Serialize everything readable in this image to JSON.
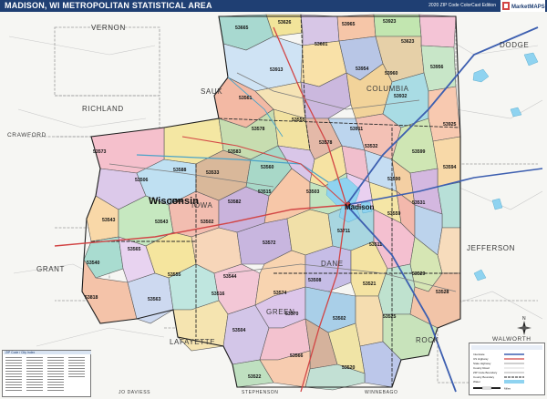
{
  "header": {
    "title": "MADISON, WI METROPOLITAN STATISTICAL AREA",
    "edition": "2020 ZIP Code ColorCast Edition",
    "logo_text": "MarketMAPS"
  },
  "colors": {
    "header_bg": "#1f3f73",
    "water": "#8fd3f0",
    "outside_area": "#f5f5f2",
    "road_interstate": "#3d5fb0",
    "road_us": "#d24545"
  },
  "counties": [
    {
      "name": "VERNON"
    },
    {
      "name": "SAUK"
    },
    {
      "name": "COLUMBIA"
    },
    {
      "name": "DODGE"
    },
    {
      "name": "RICHLAND"
    },
    {
      "name": "CRAWFORD"
    },
    {
      "name": "IOWA"
    },
    {
      "name": "DANE"
    },
    {
      "name": "JEFFERSON"
    },
    {
      "name": "GRANT"
    },
    {
      "name": "LAFAYETTE"
    },
    {
      "name": "GREEN"
    },
    {
      "name": "ROCK"
    },
    {
      "name": "WALWORTH"
    },
    {
      "name": "JO DAVIESS"
    },
    {
      "name": "STEPHENSON"
    },
    {
      "name": "WINNEBAGO"
    }
  ],
  "cities": [
    {
      "name": "Wisconsin"
    },
    {
      "name": "Madison"
    }
  ],
  "zip_codes": [
    "53665",
    "53626",
    "53965",
    "53923",
    "53601",
    "53623",
    "53954",
    "53913",
    "53960",
    "53956",
    "53561",
    "53932",
    "53555",
    "53911",
    "53925",
    "53578",
    "53578",
    "53532",
    "53573",
    "53583",
    "53560",
    "53599",
    "53588",
    "53533",
    "53590",
    "53506",
    "53515",
    "53503",
    "53594",
    "53531",
    "53543",
    "53502",
    "53572",
    "53711",
    "53511",
    "53540",
    "53588",
    "53543",
    "53582",
    "53559",
    "53565",
    "53544",
    "53508",
    "53521",
    "53555",
    "53818",
    "53516",
    "53574",
    "53566",
    "53502",
    "53570",
    "53504",
    "53563",
    "53525",
    "53520",
    "53522",
    "53529",
    "53528"
  ],
  "legend": {
    "rows": [
      {
        "label": "Interstate",
        "color": "#3d5fb0"
      },
      {
        "label": "US Highway",
        "color": "#d24545"
      },
      {
        "label": "State Highway",
        "color": "#7b7b7b"
      },
      {
        "label": "County Road",
        "color": "#b0b0b0"
      },
      {
        "label": "ZIP Code Boundary",
        "color": "#555555"
      },
      {
        "label": "County Boundary",
        "color": "#222222"
      },
      {
        "label": "Water",
        "color": "#8fd3f0"
      }
    ],
    "scale_label": "Miles"
  },
  "index": {
    "title": "ZIP Code / City Index"
  },
  "compass": {
    "north_label": "N"
  }
}
